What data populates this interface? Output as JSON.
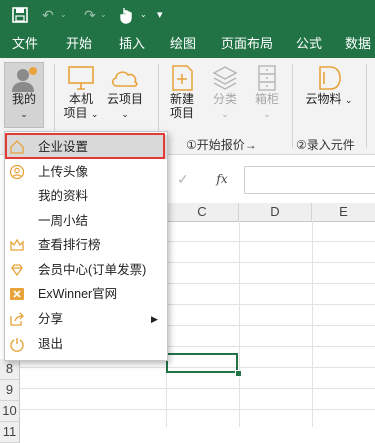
{
  "menu": {
    "items": [
      "文件",
      "开始",
      "插入",
      "绘图",
      "页面布局",
      "公式",
      "数据"
    ]
  },
  "ribbon": {
    "my_label": "我的",
    "local_label_1": "本机",
    "local_label_2": "项目",
    "cloud_label": "云项目",
    "new_label_1": "新建",
    "new_label_2": "项目",
    "category_label": "分类",
    "box_label_1": "箱柜",
    "cloud_material_label": "云物料",
    "group1_label": "①开始报价→",
    "group2_label": "②录入元件"
  },
  "formula_bar": {
    "fx_label": "fx"
  },
  "grid": {
    "columns": [
      "C",
      "D",
      "E"
    ],
    "rows": [
      "8",
      "9",
      "10",
      "11"
    ]
  },
  "dropdown": {
    "items": [
      {
        "label": "企业设置",
        "icon": "home-icon"
      },
      {
        "label": "上传头像",
        "icon": "user-circle-icon"
      },
      {
        "label": "我的资料",
        "icon": ""
      },
      {
        "label": "一周小结",
        "icon": ""
      },
      {
        "label": "查看排行榜",
        "icon": "crown-icon"
      },
      {
        "label": "会员中心(订单发票)",
        "icon": "diamond-icon"
      },
      {
        "label": "ExWinner官网",
        "icon": "exwinner-logo-icon"
      },
      {
        "label": "分享",
        "icon": "share-icon"
      },
      {
        "label": "退出",
        "icon": "power-icon"
      }
    ],
    "highlight_color": "#e53935",
    "accent_color": "#e8a33a"
  },
  "colors": {
    "brand_green": "#217346"
  }
}
